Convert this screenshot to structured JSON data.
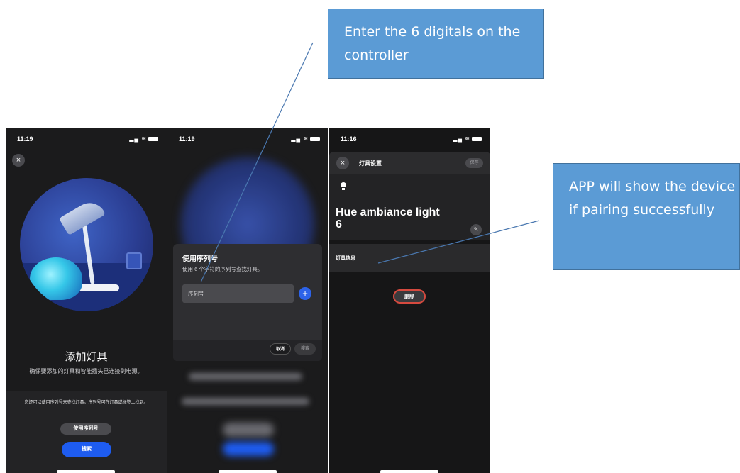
{
  "phone1": {
    "status": {
      "time": "11:19",
      "signal": "▂▄ ≋"
    },
    "close_icon": "×",
    "title": "添加灯具",
    "subtitle": "确保要添加的灯具和智能插头已连接到电源。",
    "note": "您还可以使用序列号来查找灯具。序列号可在灯具或标签上找到。",
    "use_serial_label": "使用序列号",
    "search_label": "搜索"
  },
  "phone2": {
    "status": {
      "time": "11:19",
      "signal": "▂▄ ≋"
    },
    "dialog": {
      "title": "使用序列号",
      "subtitle": "使用 6 个字符的序列号查找灯具。",
      "input_placeholder": "序列号",
      "plus_icon": "+",
      "cancel_label": "取消",
      "search_label": "搜索"
    }
  },
  "phone3": {
    "status": {
      "time": "11:16",
      "signal": "▂▄ ≋"
    },
    "header": {
      "close_icon": "×",
      "title": "灯具设置",
      "save_label": "保存"
    },
    "light_name": "Hue ambiance light 6",
    "edit_icon": "✎",
    "info_label": "灯具信息",
    "delete_label": "删除"
  },
  "callouts": {
    "enter_digits": "Enter the 6 digitals on the controller",
    "pairing": "APP will show the device if pairing successfully"
  },
  "colors": {
    "accent_blue": "#1e5cf0",
    "callout_fill": "#5b9bd5",
    "callout_border": "#41719c",
    "delete_red": "#d64a3f"
  }
}
